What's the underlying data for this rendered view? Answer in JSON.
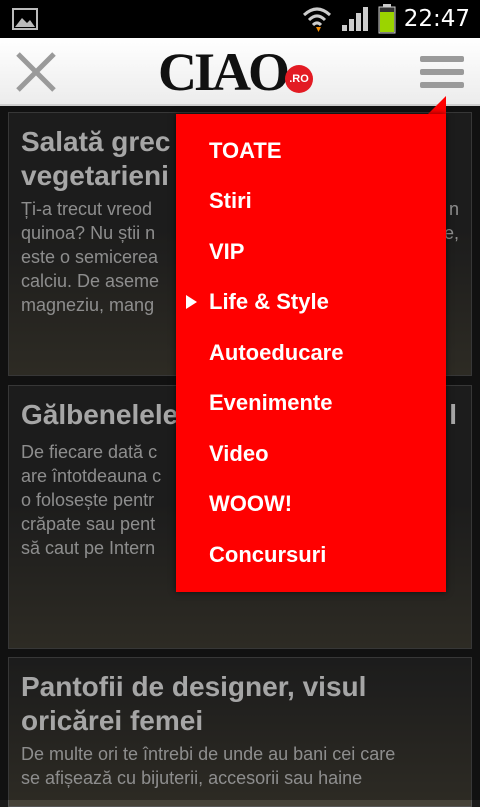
{
  "status_bar": {
    "time": "22:47"
  },
  "header": {
    "logo_text": "CIAO",
    "logo_badge": ".RO"
  },
  "articles": [
    {
      "title_line1": "Salată grec",
      "title_line2": "vegetarieni",
      "text": [
        "Ți-a trecut vreod",
        "quinoa? Nu știi n",
        "este o semicerea",
        "calciu. De aseme",
        "magneziu, mang"
      ],
      "text_right": [
        "n",
        "e,",
        "",
        "",
        ""
      ]
    },
    {
      "title_line1": "Gălbenelele",
      "title_line2": "",
      "text": [
        "De fiecare dată c",
        "are întotdeauna c",
        "o folosește pentr",
        "crăpate sau pent",
        "să caut pe Intern"
      ],
      "title_right": "l"
    },
    {
      "title_line1": "Pantofii de designer, visul",
      "title_line2": "oricărei femei",
      "text": [
        "De multe ori te întrebi de unde au bani cei care",
        "se afișează cu bijuterii, accesorii sau haine"
      ]
    }
  ],
  "menu": {
    "items": [
      "TOATE",
      "Stiri",
      "VIP",
      "Life & Style",
      "Autoeducare",
      "Evenimente",
      "Video",
      "WOOW!",
      "Concursuri"
    ],
    "selected": "Life & Style"
  }
}
